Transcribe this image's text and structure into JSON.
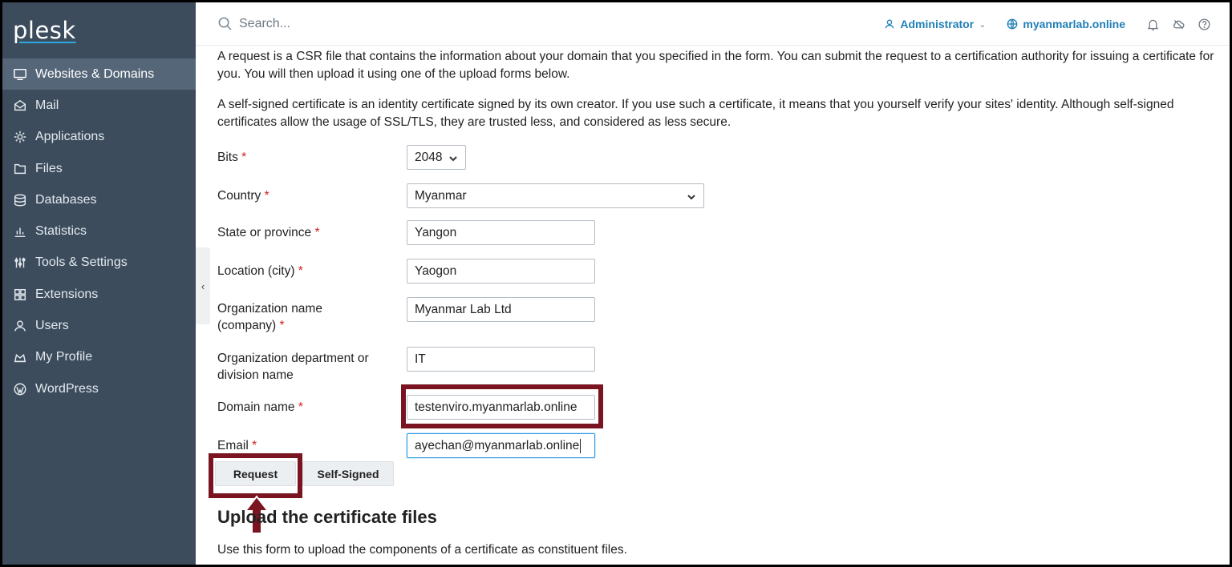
{
  "app": {
    "logo": "plesk"
  },
  "sidebar": {
    "items": [
      {
        "label": "Websites & Domains",
        "icon": "monitor-icon",
        "active": true
      },
      {
        "label": "Mail",
        "icon": "mail-icon"
      },
      {
        "label": "Applications",
        "icon": "gear-icon"
      },
      {
        "label": "Files",
        "icon": "folder-icon"
      },
      {
        "label": "Databases",
        "icon": "database-icon"
      },
      {
        "label": "Statistics",
        "icon": "bar-chart-icon"
      },
      {
        "label": "Tools & Settings",
        "icon": "sliders-icon"
      },
      {
        "label": "Extensions",
        "icon": "grid-icon"
      },
      {
        "label": "Users",
        "icon": "user-icon"
      },
      {
        "label": "My Profile",
        "icon": "profile-icon"
      },
      {
        "label": "WordPress",
        "icon": "wordpress-icon"
      }
    ],
    "collapse_glyph": "‹"
  },
  "header": {
    "search_placeholder": "Search...",
    "user": "Administrator",
    "domain": "myanmarlab.online"
  },
  "intro": {
    "p1": "A request is a CSR file that contains the information about your domain that you specified in the form. You can submit the request to a certification authority for issuing a certificate for you. You will then upload it using one of the upload forms below.",
    "p2": "A self-signed certificate is an identity certificate signed by its own creator. If you use such a certificate, it means that you yourself verify your sites' identity. Although self-signed certificates allow the usage of SSL/TLS, they are trusted less, and considered as less secure."
  },
  "form": {
    "bits": {
      "label": "Bits",
      "value": "2048"
    },
    "country": {
      "label": "Country",
      "value": "Myanmar"
    },
    "state": {
      "label": "State or province",
      "value": "Yangon"
    },
    "city": {
      "label": "Location (city)",
      "value": "Yaogon"
    },
    "org": {
      "label_line1": "Organization name",
      "label_line2": "(company)",
      "value": "Myanmar Lab Ltd"
    },
    "dept": {
      "label_line1": "Organization department or",
      "label_line2": "division name",
      "value": "IT"
    },
    "domain": {
      "label": "Domain name",
      "value": "testenviro.myanmarlab.online"
    },
    "email": {
      "label": "Email",
      "value": "ayechan@myanmarlab.online"
    },
    "required_mark": "*"
  },
  "buttons": {
    "request": "Request",
    "self_signed": "Self-Signed"
  },
  "upload": {
    "title": "Upload the certificate files",
    "desc": "Use this form to upload the components of a certificate as constituent files."
  },
  "colors": {
    "sidebar": "#3c4c5c",
    "active": "#556678",
    "link": "#1f7fb6",
    "highlight": "#7a1420",
    "required": "#d02020"
  }
}
